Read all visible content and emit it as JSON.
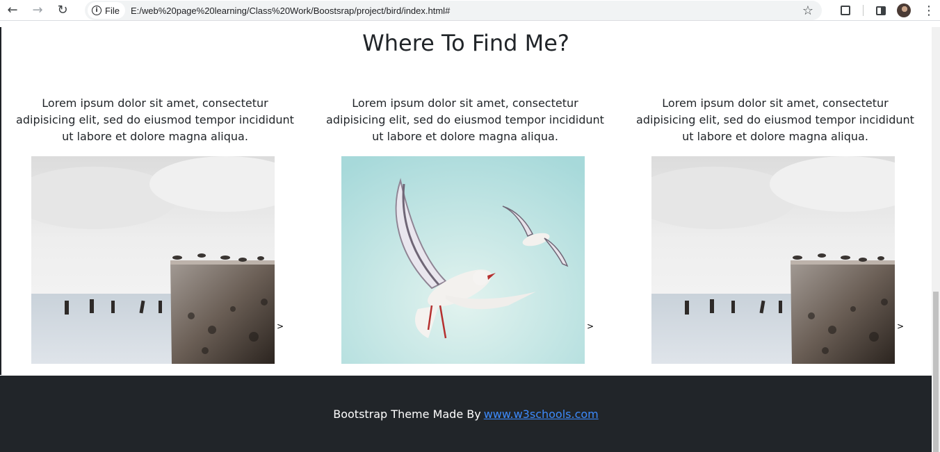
{
  "browser": {
    "chip_label": "File",
    "url": "E:/web%20page%20learning/Class%20Work/Boostsrap/project/bird/index.html#",
    "icons": [
      "back-icon",
      "forward-icon",
      "reload-icon",
      "info-icon",
      "star-icon",
      "extensions-icon",
      "side-panel-icon",
      "avatar",
      "menu-icon"
    ]
  },
  "section": {
    "title": "Where To Find Me?",
    "columns": [
      {
        "text": "Lorem ipsum dolor sit amet, consectetur adipisicing elit, sed do eiusmod tempor incididunt ut labore et dolore magna aliqua.",
        "image": "pier-with-birds",
        "arrow": ">"
      },
      {
        "text": "Lorem ipsum dolor sit amet, consectetur adipisicing elit, sed do eiusmod tempor incididunt ut labore et dolore magna aliqua.",
        "image": "seagulls-flying",
        "arrow": ">"
      },
      {
        "text": "Lorem ipsum dolor sit amet, consectetur adipisicing elit, sed do eiusmod tempor incididunt ut labore et dolore magna aliqua.",
        "image": "pier-with-birds",
        "arrow": ">"
      }
    ]
  },
  "footer": {
    "text": "Bootstrap Theme Made By",
    "link_text": "www.w3schools.com"
  },
  "colors": {
    "footer_bg": "#212529",
    "link": "#3d8bfd",
    "text": "#212529"
  }
}
